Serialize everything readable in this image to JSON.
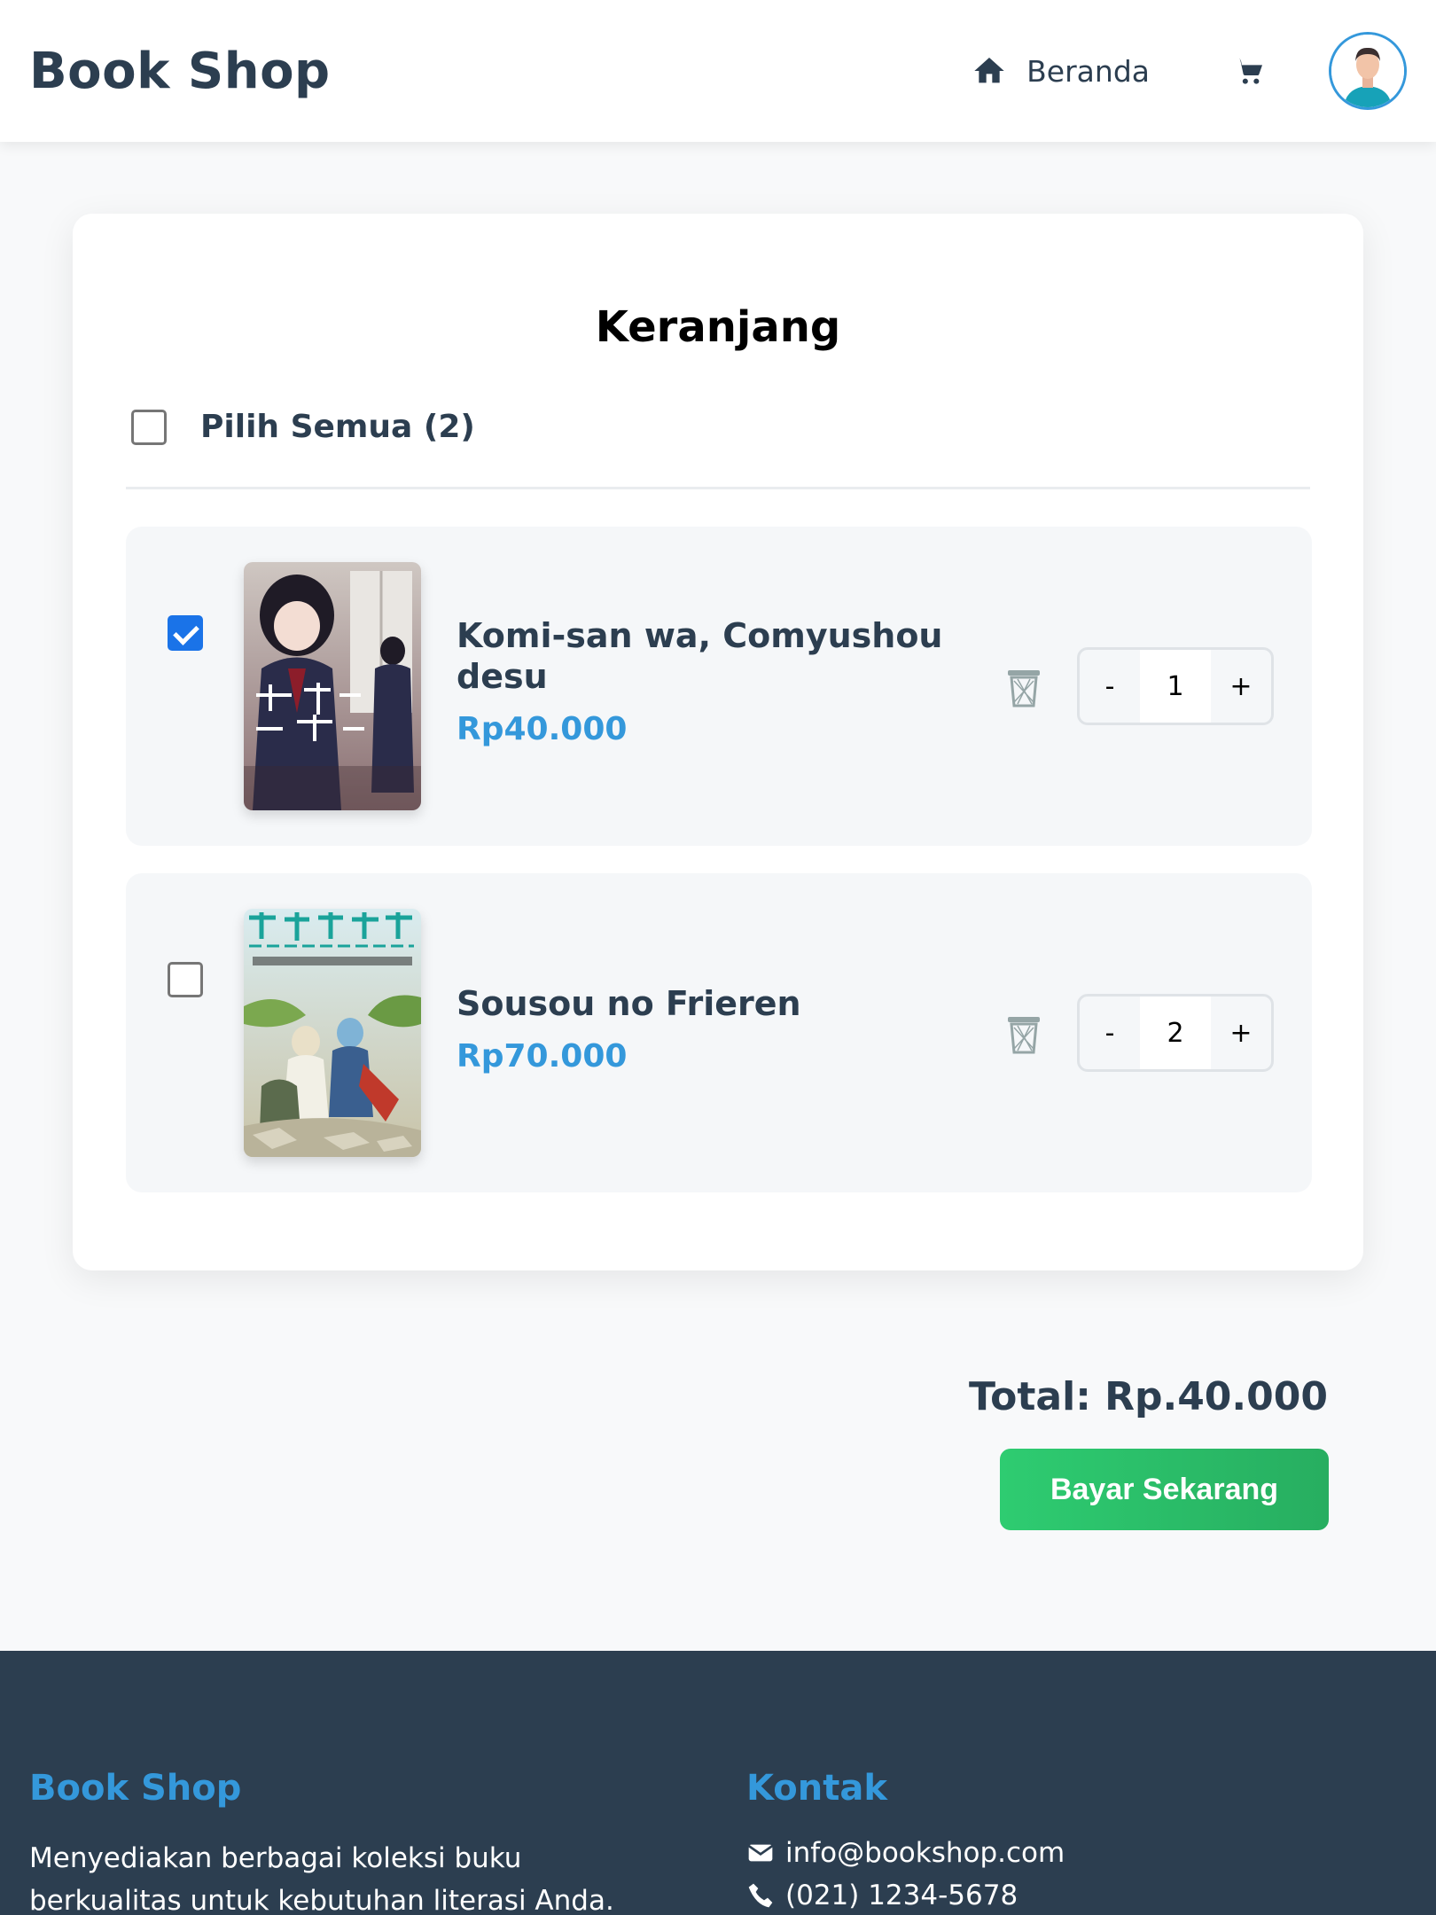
{
  "header": {
    "brand": "Book Shop",
    "nav_home_label": "Beranda",
    "home_icon": "home-icon",
    "cart_icon": "cart-icon",
    "avatar_icon": "user-avatar"
  },
  "cart": {
    "title": "Keranjang",
    "select_all_label": "Pilih Semua (2)",
    "select_all_checked": false,
    "items": [
      {
        "title": "Komi-san wa, Comyushou desu",
        "price": "Rp40.000",
        "quantity": "1",
        "checked": true,
        "minus_label": "-",
        "plus_label": "+"
      },
      {
        "title": "Sousou no Frieren",
        "price": "Rp70.000",
        "quantity": "2",
        "checked": false,
        "minus_label": "-",
        "plus_label": "+"
      }
    ]
  },
  "summary": {
    "total": "Total: Rp.40.000",
    "pay_label": "Bayar Sekarang"
  },
  "footer": {
    "about_heading": "Book Shop",
    "about_text": "Menyediakan berbagai koleksi buku berkualitas untuk kebutuhan literasi Anda.",
    "contact_heading": "Kontak",
    "email": "info@bookshop.com",
    "phone": "(021) 1234-5678"
  },
  "colors": {
    "primary": "#2c3e50",
    "accent": "#3498db",
    "pay_button": "#2ecc71",
    "checkbox_checked": "#1a73e8"
  }
}
